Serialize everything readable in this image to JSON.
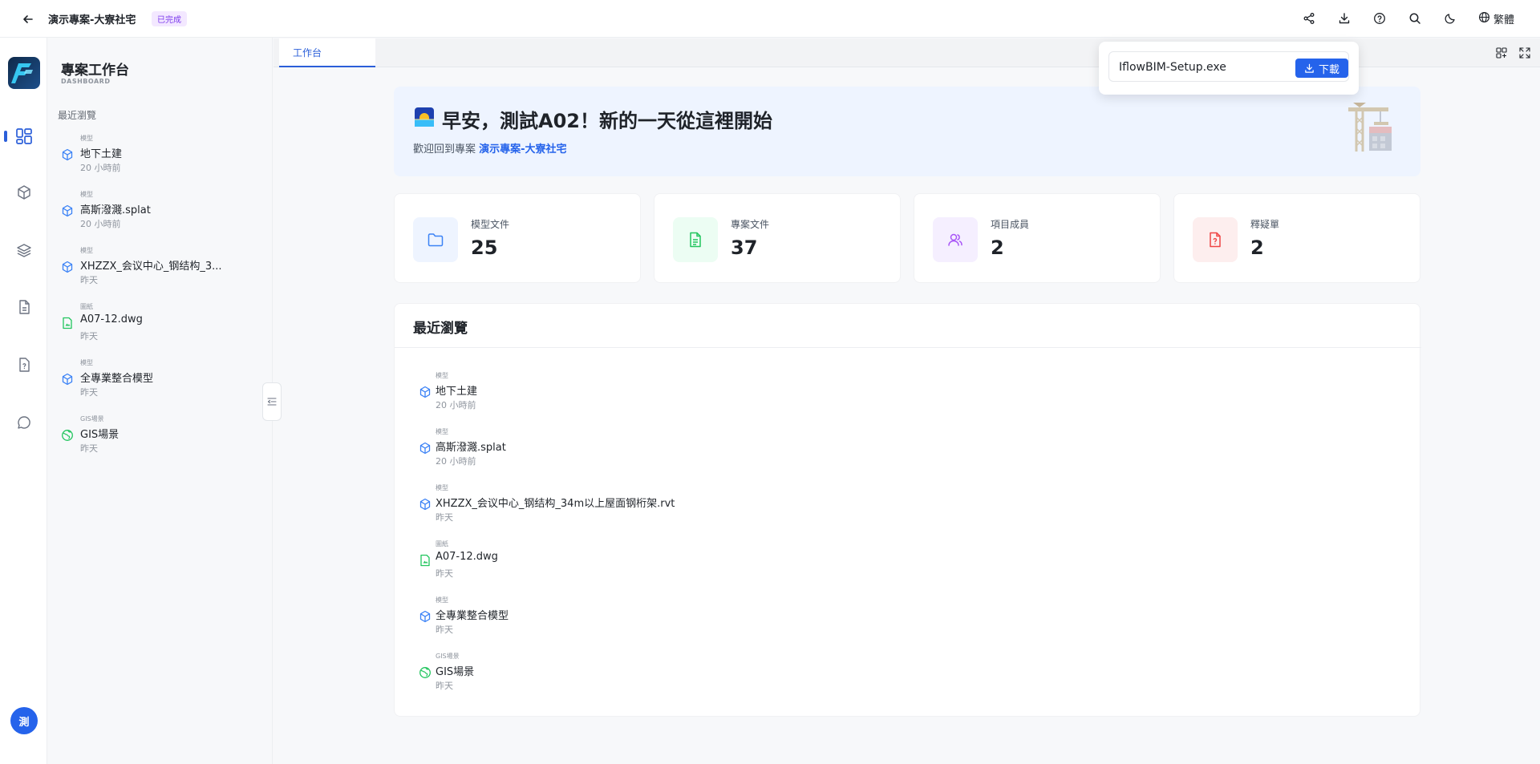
{
  "header": {
    "project_title": "演示專案-大寮社宅",
    "status": "已完成",
    "language": "繁體",
    "icons": [
      "share-icon",
      "download-icon",
      "help-icon",
      "search-icon",
      "moon-icon",
      "globe-icon"
    ]
  },
  "rail": {
    "avatar_initial": "測",
    "items": [
      "dashboard-icon",
      "cube-icon",
      "layers-icon",
      "document-icon",
      "question-doc-icon",
      "chat-icon"
    ]
  },
  "sidepanel": {
    "title": "專案工作台",
    "subtitle": "DASHBOARD",
    "section": "最近瀏覽",
    "items": [
      {
        "kind": "模型",
        "name": "地下土建",
        "time": "20 小時前",
        "icon": "cube"
      },
      {
        "kind": "模型",
        "name": "高斯潑濺.splat",
        "time": "20 小時前",
        "icon": "cube"
      },
      {
        "kind": "模型",
        "name": "XHZZX_会议中心_钢结构_3...",
        "time": "昨天",
        "icon": "cube"
      },
      {
        "kind": "圖紙",
        "name": "A07-12.dwg",
        "time": "昨天",
        "icon": "drawing"
      },
      {
        "kind": "模型",
        "name": "全專業整合模型",
        "time": "昨天",
        "icon": "cube"
      },
      {
        "kind": "GIS場景",
        "name": "GIS場景",
        "time": "昨天",
        "icon": "globe"
      }
    ]
  },
  "tabs": {
    "active": "工作台"
  },
  "popover": {
    "filename": "IflowBIM-Setup.exe",
    "button": "下載"
  },
  "welcome": {
    "title": "早安，測試A02！新的一天從這裡開始",
    "prefix": "歡迎回到專案",
    "project_link": "演示專案-大寮社宅"
  },
  "stats": [
    {
      "label": "模型文件",
      "value": "25",
      "color": "#3b82f6",
      "bg": "#eef4ff"
    },
    {
      "label": "專案文件",
      "value": "37",
      "color": "#22c55e",
      "bg": "#ecfdf3"
    },
    {
      "label": "項目成員",
      "value": "2",
      "color": "#a855f7",
      "bg": "#f5efff"
    },
    {
      "label": "釋疑單",
      "value": "2",
      "color": "#ef4444",
      "bg": "#fdeeee"
    }
  ],
  "recent": {
    "title": "最近瀏覽",
    "items": [
      {
        "kind": "模型",
        "name": "地下土建",
        "time": "20 小時前",
        "icon": "cube"
      },
      {
        "kind": "模型",
        "name": "高斯潑濺.splat",
        "time": "20 小時前",
        "icon": "cube"
      },
      {
        "kind": "模型",
        "name": "XHZZX_会议中心_钢结构_34m以上屋面钢桁架.rvt",
        "time": "昨天",
        "icon": "cube"
      },
      {
        "kind": "圖紙",
        "name": "A07-12.dwg",
        "time": "昨天",
        "icon": "drawing"
      },
      {
        "kind": "模型",
        "name": "全專業整合模型",
        "time": "昨天",
        "icon": "cube"
      },
      {
        "kind": "GIS場景",
        "name": "GIS場景",
        "time": "昨天",
        "icon": "globe"
      }
    ]
  }
}
